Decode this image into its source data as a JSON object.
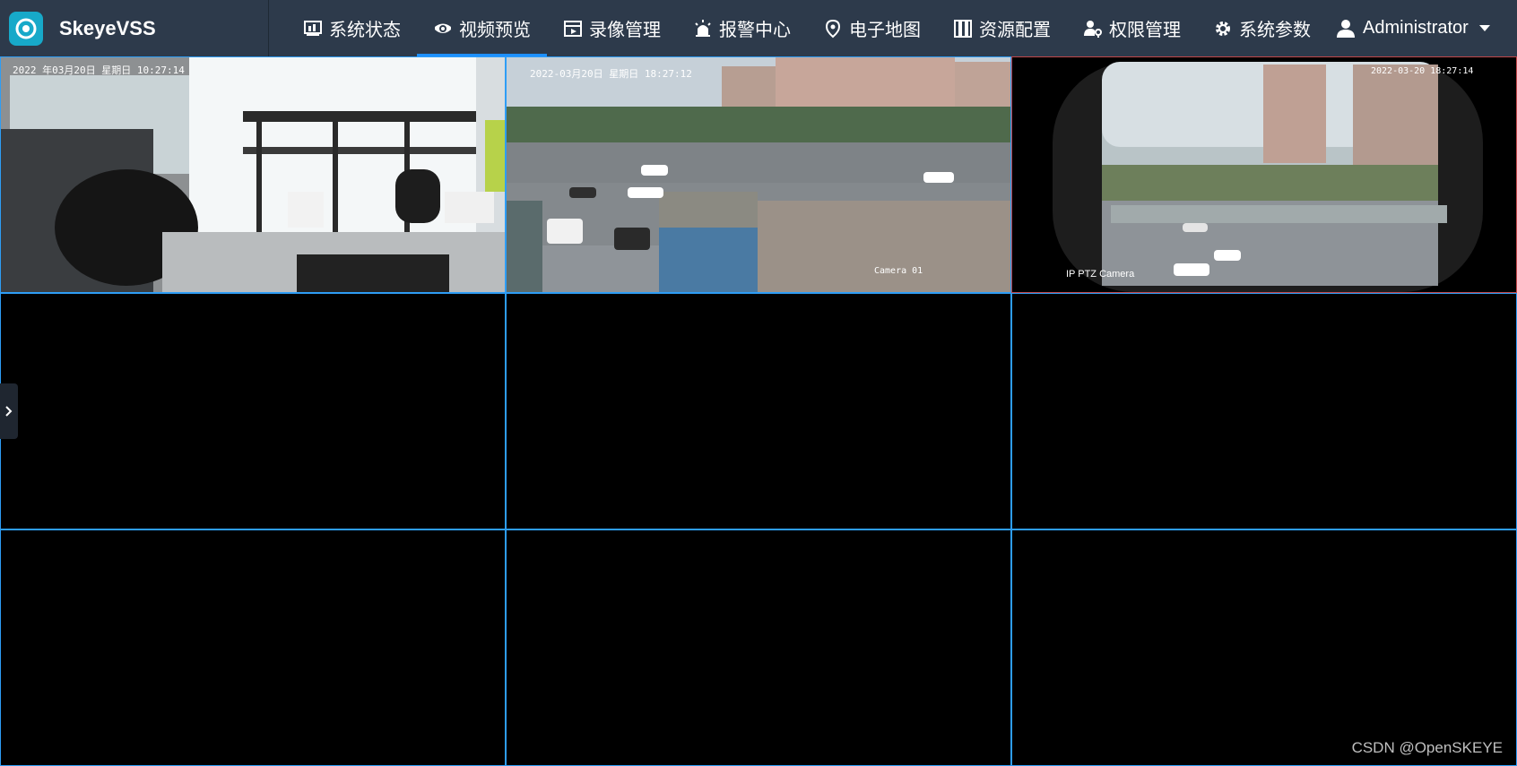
{
  "app": {
    "name": "SkeyeVSS"
  },
  "nav": [
    {
      "label": "系统状态",
      "icon": "chart-icon",
      "active": false
    },
    {
      "label": "视频预览",
      "icon": "camera-icon",
      "active": true
    },
    {
      "label": "录像管理",
      "icon": "film-icon",
      "active": false
    },
    {
      "label": "报警中心",
      "icon": "alarm-icon",
      "active": false
    },
    {
      "label": "电子地图",
      "icon": "map-pin-icon",
      "active": false
    },
    {
      "label": "资源配置",
      "icon": "server-icon",
      "active": false
    },
    {
      "label": "权限管理",
      "icon": "user-key-icon",
      "active": false
    },
    {
      "label": "系统参数",
      "icon": "gear-icon",
      "active": false
    }
  ],
  "user": {
    "name": "Administrator",
    "icon": "user-icon"
  },
  "cameras": [
    {
      "osd": "2022 年03月20日  星期日  10:27:14",
      "caption": ""
    },
    {
      "osd": "2022-03月20日 星期日 18:27:12",
      "caption": "Camera 01"
    },
    {
      "osd": "2022-03-20 18:27:14",
      "caption": "IP PTZ Camera"
    }
  ],
  "watermark": "CSDN @OpenSKEYE",
  "colors": {
    "topbar": "#2d3a4b",
    "cell_border": "#2e9df5",
    "active_tab": "#1e90ff",
    "logo": "#17a9c9"
  }
}
